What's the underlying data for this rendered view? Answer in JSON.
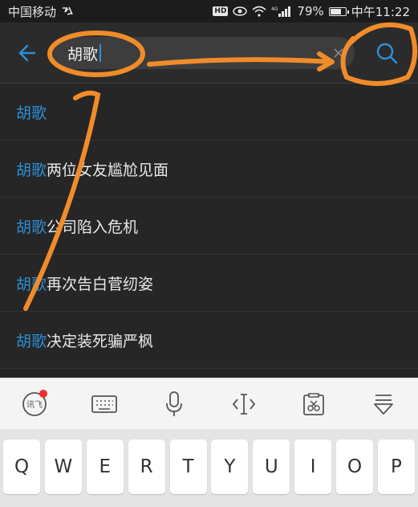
{
  "status_bar": {
    "carrier": "中国移动",
    "battery_percent": "79%",
    "battery_level": 0.79,
    "time": "中午11:22",
    "icons": [
      "hd-icon",
      "eye-icon",
      "wifi-icon",
      "4g-signal-icon",
      "battery-icon"
    ]
  },
  "search": {
    "query": "胡歌",
    "back_icon": "back-arrow-icon",
    "clear_icon": "clear-icon",
    "search_icon": "search-icon"
  },
  "suggestions": [
    {
      "highlight": "胡歌",
      "rest": ""
    },
    {
      "highlight": "胡歌",
      "rest": "两位女友尴尬见面"
    },
    {
      "highlight": "胡歌",
      "rest": "公司陷入危机"
    },
    {
      "highlight": "胡歌",
      "rest": "再次告白菅纫姿"
    },
    {
      "highlight": "胡歌",
      "rest": "决定装死骗严枫"
    }
  ],
  "keyboard": {
    "toolbar_icons": [
      "ifly-logo-icon",
      "keyboard-icon",
      "microphone-icon",
      "cursor-move-icon",
      "clipboard-icon",
      "hide-keyboard-icon"
    ],
    "toolbar_badge": "ifly-logo-icon",
    "keys": [
      "Q",
      "W",
      "E",
      "R",
      "T",
      "Y",
      "U",
      "I",
      "O",
      "P"
    ]
  },
  "colors": {
    "accent": "#2e8fd6",
    "annotation": "#f08c2a",
    "background": "#262626"
  }
}
